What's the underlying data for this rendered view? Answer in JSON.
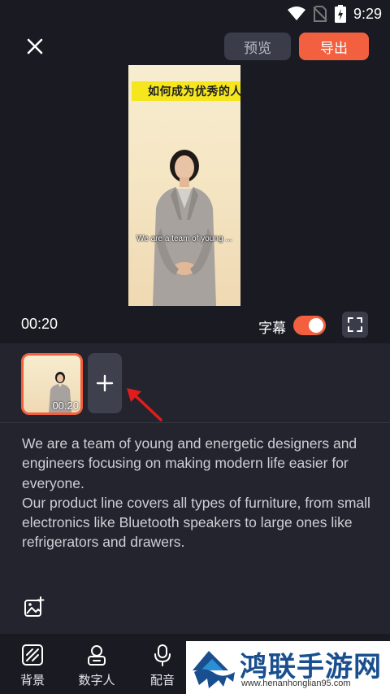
{
  "status_bar": {
    "time": "9:29"
  },
  "header": {
    "preview_label": "预览",
    "export_label": "导出"
  },
  "video": {
    "title_overlay": "如何成为优秀的人",
    "subtitle_overlay": "We are a team of young ..."
  },
  "playback": {
    "timecode": "00:20",
    "subtitle_toggle_label": "字幕",
    "subtitles_on": true
  },
  "timeline": {
    "clip_duration": "00:20",
    "add_clip_glyph": "+"
  },
  "script": {
    "paragraphs": [
      "We are a team of young and energetic designers and engineers focusing on making modern life easier for everyone.",
      "Our product line covers all types of furniture, from small electronics like Bluetooth speakers to large ones like refrigerators and drawers."
    ]
  },
  "bottom_nav": {
    "items": [
      {
        "label": "背景",
        "icon": "background-icon"
      },
      {
        "label": "数字人",
        "icon": "digital-human-icon"
      },
      {
        "label": "配音",
        "icon": "microphone-icon"
      }
    ]
  },
  "watermark": {
    "title": "鸿联手游网",
    "url": "www.henanhonglian95.com"
  },
  "colors": {
    "accent": "#f2603f",
    "background": "#23242d",
    "dark": "#1a1b22"
  }
}
